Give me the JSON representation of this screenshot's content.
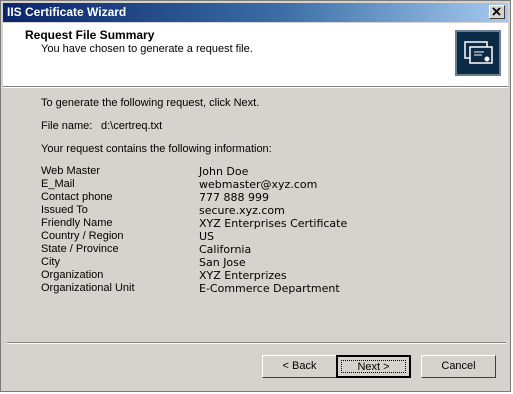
{
  "window": {
    "title": "IIS Certificate Wizard",
    "close_label": "×"
  },
  "header": {
    "title": "Request File Summary",
    "subtitle": "You have chosen to generate a request file."
  },
  "body": {
    "instruction": "To generate the following request, click Next.",
    "file_name_label": "File name:",
    "file_name_value": "d:\\certreq.txt",
    "contains_text": "Your request contains the following information:",
    "info": [
      {
        "label": "Web Master",
        "value": "John Doe"
      },
      {
        "label": "E_Mail",
        "value": "webmaster@xyz.com"
      },
      {
        "label": "Contact phone",
        "value": "777 888 999"
      },
      {
        "label": "Issued To",
        "value": "secure.xyz.com"
      },
      {
        "label": "Friendly Name",
        "value": "XYZ Enterprises Certificate"
      },
      {
        "label": "Country / Region",
        "value": "US"
      },
      {
        "label": "State / Province",
        "value": "California"
      },
      {
        "label": "City",
        "value": "San Jose"
      },
      {
        "label": "Organization",
        "value": "XYZ Enterprizes"
      },
      {
        "label": "Organizational Unit",
        "value": "E-Commerce Department"
      }
    ]
  },
  "buttons": {
    "back": "< Back",
    "next": "Next >",
    "cancel": "Cancel"
  }
}
